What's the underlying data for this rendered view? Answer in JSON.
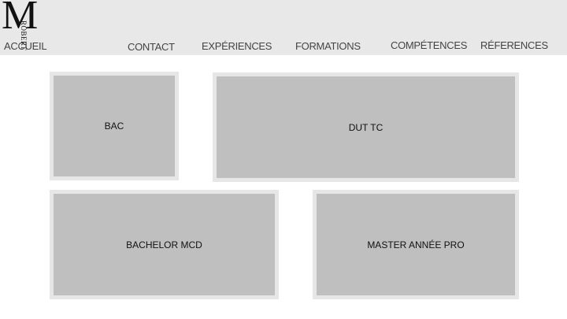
{
  "header": {
    "logo_letter": "M",
    "logo_name": "ROBERT",
    "nav": {
      "home": "ACCUEIL",
      "contact": "CONTACT",
      "experiences": "EXPÉRIENCES",
      "formations": "FORMATIONS",
      "competences": "COMPÉTENCES",
      "references": "RÉFERENCES"
    }
  },
  "main": {
    "cards": [
      {
        "label": "BAC"
      },
      {
        "label": "DUT TC"
      },
      {
        "label": "BACHELOR MCD"
      },
      {
        "label": "MASTER ANNÉE PRO"
      }
    ]
  }
}
